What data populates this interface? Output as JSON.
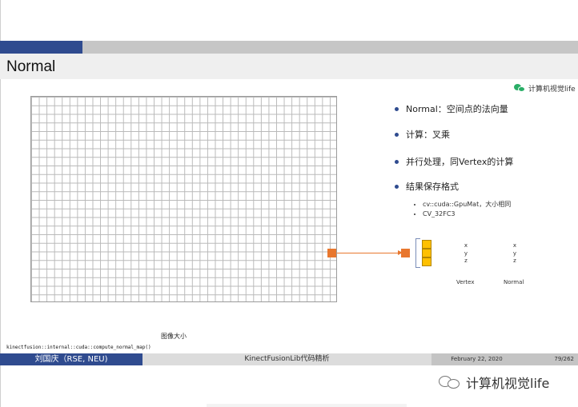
{
  "slide": {
    "title": "Normal",
    "logo_text": "计算机视觉life",
    "bullets": [
      "Normal：空间点的法向量",
      "计算：叉乘",
      "并行处理，同Vertex的计算",
      "结果保存格式"
    ],
    "sub_bullets": [
      "cv::cuda::GpuMat，大小相同",
      "CV_32FC3"
    ],
    "vertex_column": [
      "x",
      "y",
      "z"
    ],
    "normal_column": [
      "x",
      "y",
      "z"
    ],
    "vertex_label": "Vertex",
    "normal_label": "Normal",
    "grid_caption": "图像大小",
    "function_name": "kinectfusion::internal::cuda::compute_normal_map()"
  },
  "footer": {
    "author": "刘国庆（RSE, NEU)",
    "title": "KinectFusionLib代码精析",
    "date": "February 22, 2020",
    "page": "79/262"
  },
  "watermark": {
    "text": "计算机视觉life"
  },
  "colors": {
    "accent_blue": "#2f4b8f",
    "pixel_orange": "#e8772e",
    "channel_yellow": "#ffc000"
  }
}
